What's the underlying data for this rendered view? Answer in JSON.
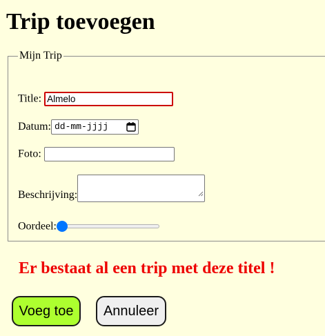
{
  "page": {
    "title": "Trip toevoegen"
  },
  "form": {
    "legend": "Mijn Trip",
    "title_label": "Title:",
    "title_value": "Almelo",
    "datum_label": "Datum:",
    "datum_placeholder": "dd-mm-jjjj",
    "foto_label": "Foto:",
    "foto_value": "",
    "beschrijving_label": "Beschrijving:",
    "beschrijving_value": "",
    "oordeel_label": "Oordeel:",
    "oordeel_value_fraction": 0
  },
  "error": {
    "message": "Er bestaat al een trip met deze titel !"
  },
  "buttons": {
    "submit_label": "Voeg toe",
    "cancel_label": "Annuleer"
  },
  "colors": {
    "page_background": "#ffffdf",
    "error_text": "#ee0000",
    "invalid_border": "#cc0000",
    "submit_background": "#adff2f",
    "cancel_background": "#efefef",
    "slider_accent": "#0075ff"
  },
  "icons": {
    "date_picker": "calendar-icon"
  }
}
